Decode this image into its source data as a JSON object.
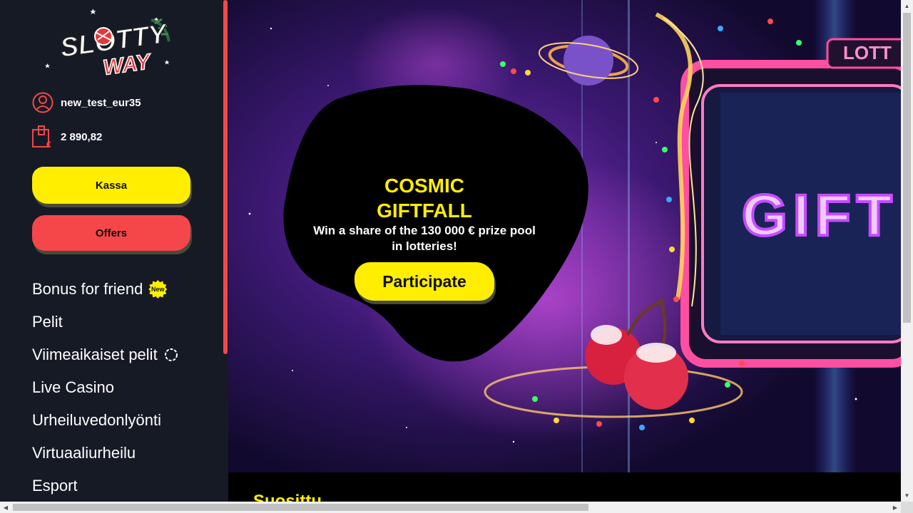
{
  "brand": {
    "logo_line1": "SLOTTY",
    "logo_line2": "WAY"
  },
  "user": {
    "username": "new_test_eur35",
    "balance": "2 890,82",
    "user_icon": "user-circle-icon",
    "wallet_icon": "wallet-euro-icon"
  },
  "buttons": {
    "kassa": "Kassa",
    "offers": "Offers"
  },
  "nav": {
    "items": [
      {
        "label": "Bonus for friend",
        "badge": "New"
      },
      {
        "label": "Pelit"
      },
      {
        "label": "Viimeaikaiset pelit",
        "icon": "loading-spinner-icon"
      },
      {
        "label": "Live Casino"
      },
      {
        "label": "Urheiluvedonlyönti"
      },
      {
        "label": "Virtuaaliurheilu"
      },
      {
        "label": "Esport"
      }
    ]
  },
  "banner": {
    "title_line1": "COSMIC",
    "title_line2": "GIFTFALL",
    "subtitle": "Win a share of the 130 000 € prize pool in lotteries!",
    "cta": "Participate",
    "sign_top": "LOTT",
    "sign_main": "GIFT"
  },
  "section": {
    "title": "Suosittu"
  },
  "colors": {
    "accent_yellow": "#ffee00",
    "accent_red": "#f5474a",
    "sidebar_bg": "#161a25"
  }
}
